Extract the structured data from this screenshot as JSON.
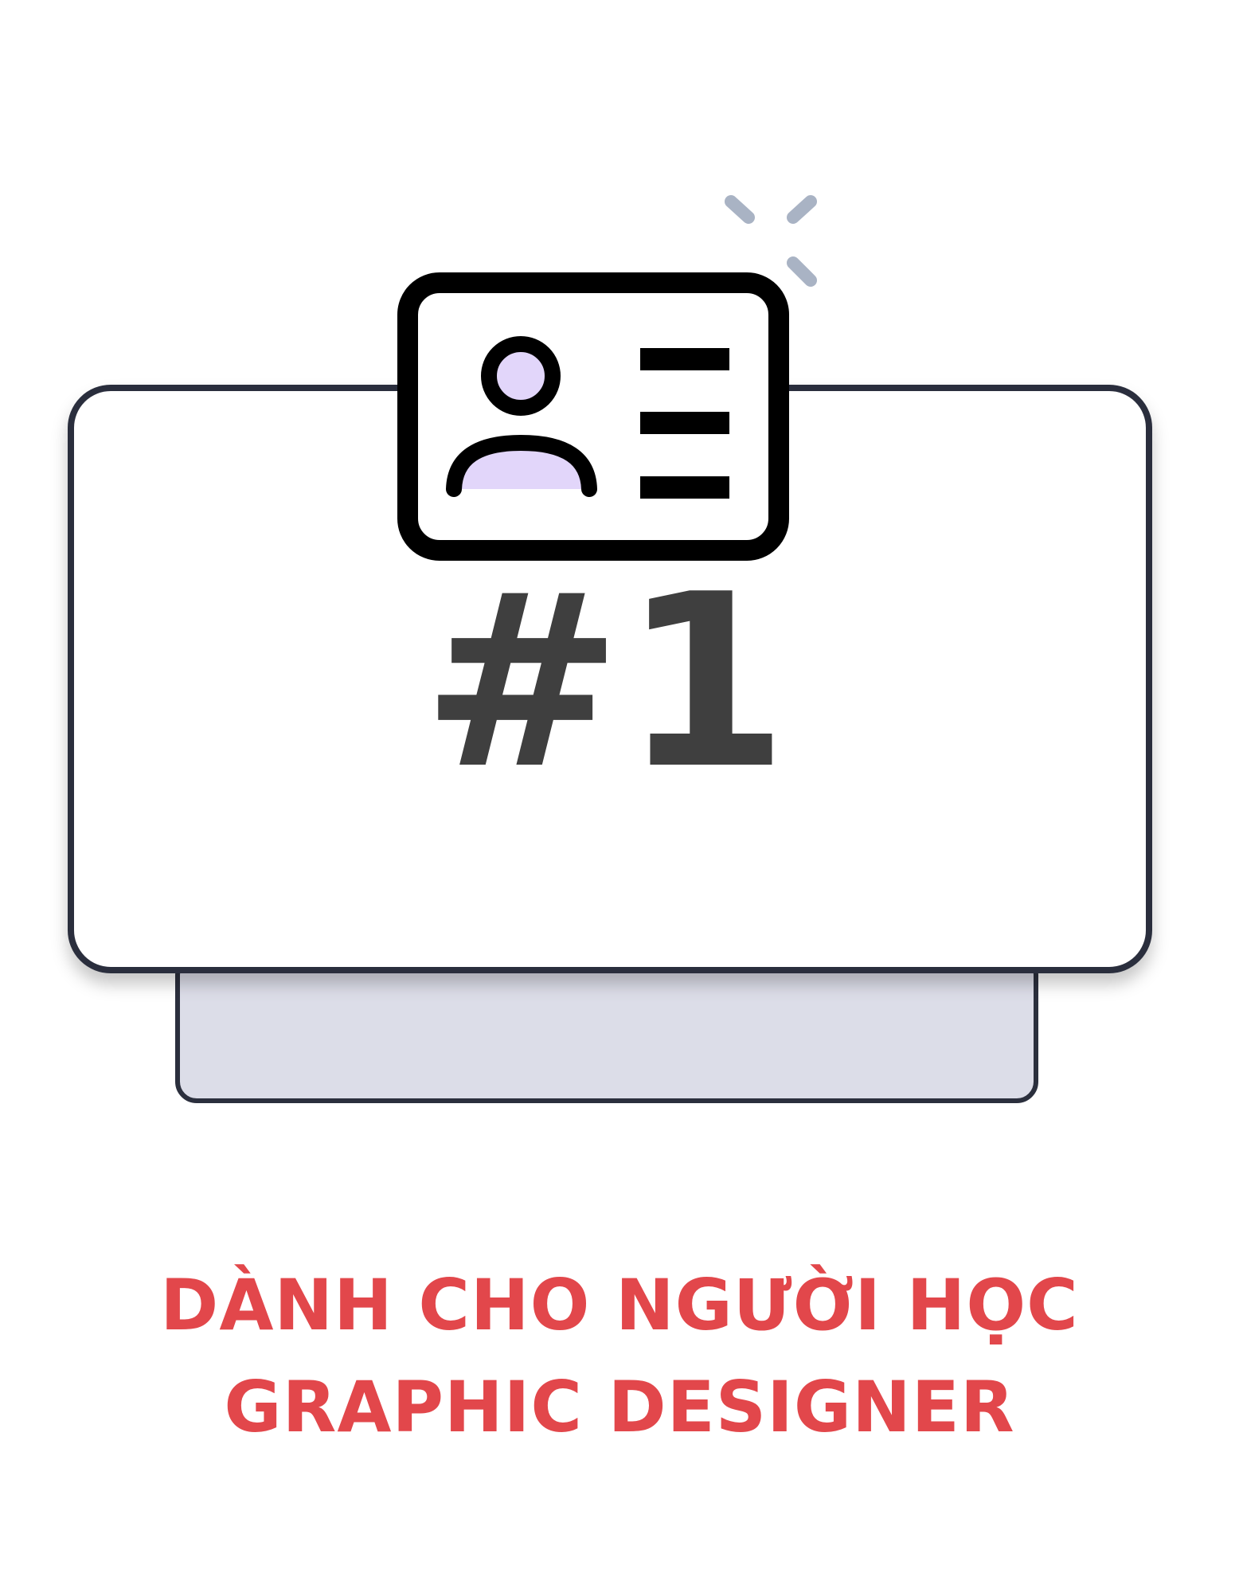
{
  "badge": {
    "rank_label": "#1",
    "icon": "id-card-icon"
  },
  "caption": {
    "line1": "DÀNH CHO NGƯỜI HỌC",
    "line2": "GRAPHIC DESIGNER"
  },
  "colors": {
    "caption": "#e2474b",
    "outline": "#2b2f3d",
    "back_card_fill": "#dcdde8",
    "avatar_fill": "#e2d6fa",
    "sparkle": "#a9b3c4",
    "rank_text": "#3f3f3f"
  }
}
